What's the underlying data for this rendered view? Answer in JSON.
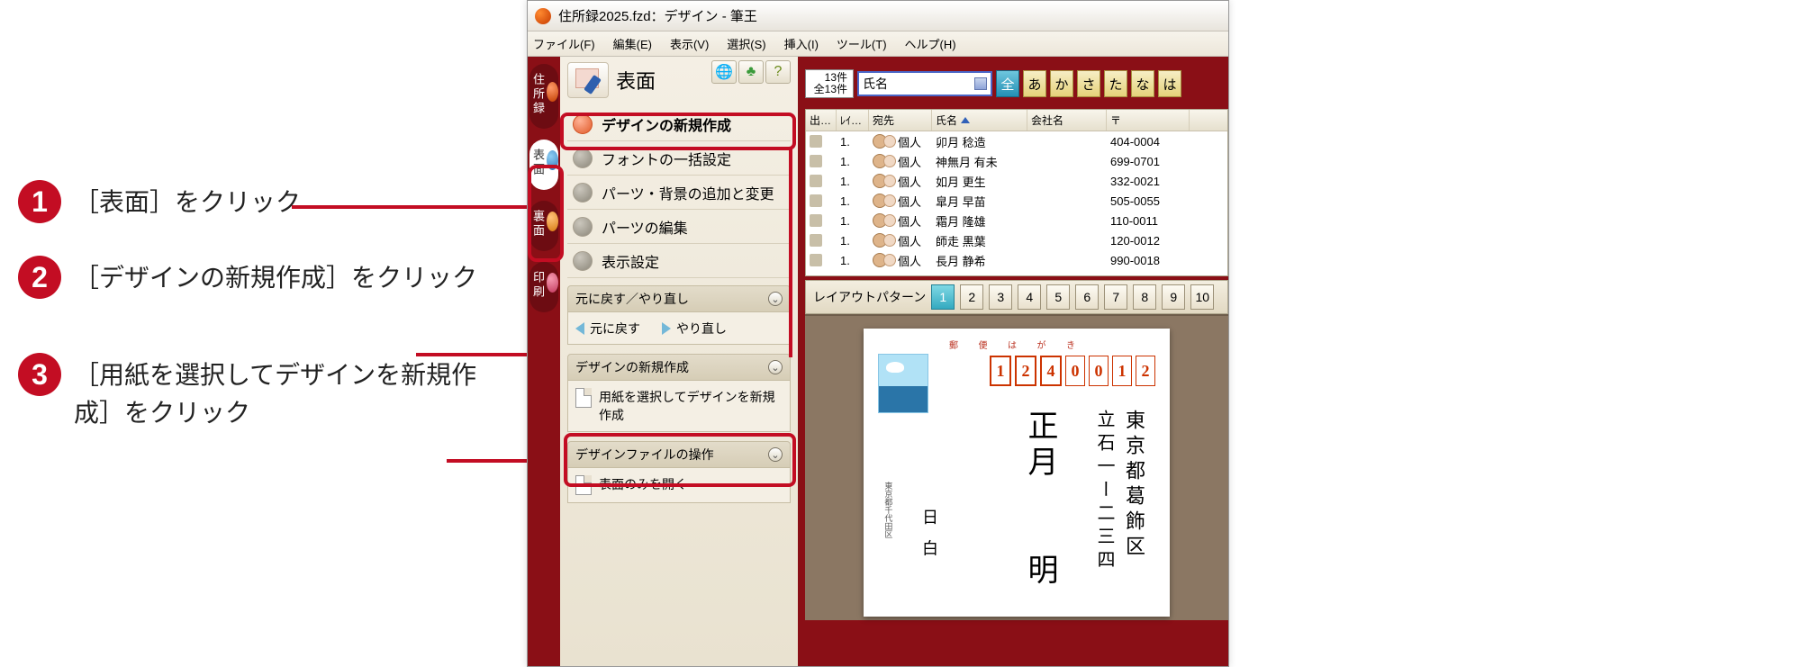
{
  "instructions": [
    {
      "num": "1",
      "text": "［表面］をクリック"
    },
    {
      "num": "2",
      "text": "［デザインの新規作成］をクリック"
    },
    {
      "num": "3",
      "text": "［用紙を選択してデザインを新規作成］をクリック"
    }
  ],
  "window": {
    "title": "住所録2025.fzd：デザイン - 筆王"
  },
  "menubar": [
    "ファイル(F)",
    "編集(E)",
    "表示(V)",
    "選択(S)",
    "挿入(I)",
    "ツール(T)",
    "ヘルプ(H)"
  ],
  "side_tabs": [
    {
      "label": "住所録",
      "active": false
    },
    {
      "label": "表面",
      "active": true
    },
    {
      "label": "裏面",
      "active": false
    },
    {
      "label": "印刷",
      "active": false
    }
  ],
  "task_header": "表面",
  "task_items": [
    {
      "label": "デザインの新規作成",
      "hot": true
    },
    {
      "label": "フォントの一括設定",
      "hot": false
    },
    {
      "label": "パーツ・背景の追加と変更",
      "hot": false
    },
    {
      "label": "パーツの編集",
      "hot": false
    },
    {
      "label": "表示設定",
      "hot": false
    }
  ],
  "undo_header": "元に戻す／やり直し",
  "undo_back": "元に戻す",
  "undo_fwd": "やり直し",
  "group1_title": "デザインの新規作成",
  "group1_item": "用紙を選択してデザインを新規作成",
  "group2_title": "デザインファイルの操作",
  "group2_item": "表面のみを開く",
  "counter_top": "13件",
  "counter_bot": "全13件",
  "name_dd": "氏名",
  "kana_buttons": [
    "全",
    "あ",
    "か",
    "さ",
    "た",
    "な",
    "は"
  ],
  "grid_headers": [
    "出…",
    "ﾚｲ…",
    "宛先",
    "氏名",
    "会社名",
    "〒"
  ],
  "grid_rows": [
    {
      "layer": "1.",
      "dest": "個人",
      "name": "卯月 稔造",
      "zip": "404-0004"
    },
    {
      "layer": "1.",
      "dest": "個人",
      "name": "神無月 有未",
      "zip": "699-0701"
    },
    {
      "layer": "1.",
      "dest": "個人",
      "name": "如月 更生",
      "zip": "332-0021"
    },
    {
      "layer": "1.",
      "dest": "個人",
      "name": "皐月 早苗",
      "zip": "505-0055"
    },
    {
      "layer": "1.",
      "dest": "個人",
      "name": "霜月 隆雄",
      "zip": "110-0011"
    },
    {
      "layer": "1.",
      "dest": "個人",
      "name": "師走 黒葉",
      "zip": "120-0012"
    },
    {
      "layer": "1.",
      "dest": "個人",
      "name": "長月 静希",
      "zip": "990-0018"
    }
  ],
  "layout_label": "レイアウトパターン",
  "layout_buttons": [
    "1",
    "2",
    "3",
    "4",
    "5",
    "6",
    "7",
    "8",
    "9",
    "10"
  ],
  "hagaki": {
    "top_label": "郵 便 は が き",
    "zip": [
      "1",
      "2",
      "4",
      "0",
      "0",
      "1",
      "2"
    ],
    "addr1": "東京都葛飾区",
    "addr2": "立石一ー二三四",
    "name": "正月　　明",
    "date": "日 白"
  }
}
